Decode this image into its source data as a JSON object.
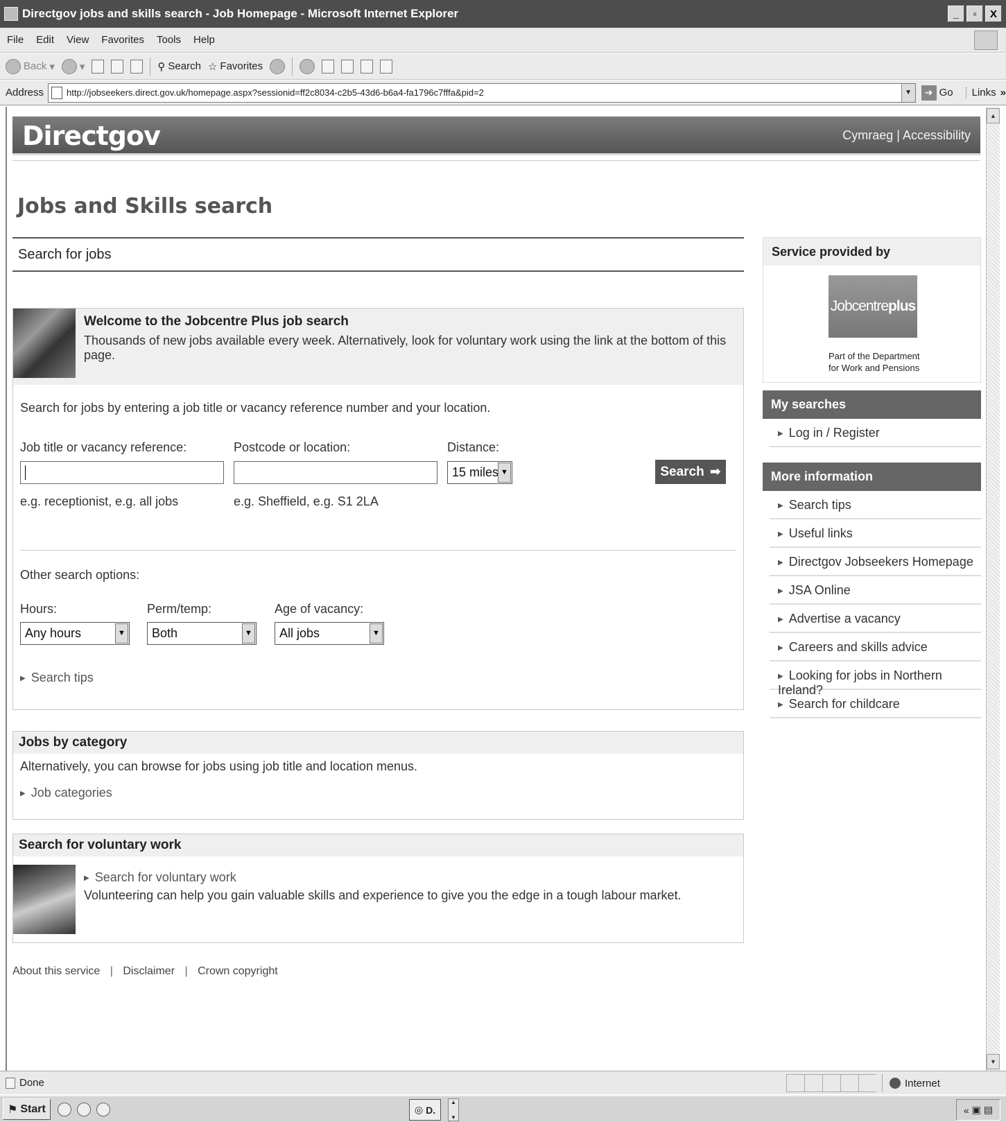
{
  "window": {
    "title": "Directgov jobs and skills search - Job Homepage - Microsoft Internet Explorer",
    "buttons": [
      "_",
      "̱",
      "X"
    ]
  },
  "menubar": [
    "File",
    "Edit",
    "View",
    "Favorites",
    "Tools",
    "Help"
  ],
  "toolbar": {
    "back": "Back",
    "search": "Search",
    "favorites": "Favorites"
  },
  "addressbar": {
    "label": "Address",
    "url": "http://jobseekers.direct.gov.uk/homepage.aspx?sessionid=ff2c8034-c2b5-43d6-b6a4-fa1796c7fffa&pid=2",
    "go": "Go",
    "links": "Links"
  },
  "site": {
    "logo": "Directgov",
    "toplinks": [
      "Cymraeg",
      "Accessibility"
    ],
    "toplink_sep": "|",
    "page_title": "Jobs and Skills search"
  },
  "search": {
    "heading": "Search for jobs",
    "welcome_title": "Welcome to the Jobcentre Plus job search",
    "welcome_text": "Thousands of new jobs available every week. Alternatively, look for voluntary work using the link at the bottom of this page.",
    "intro": "Search for jobs by entering a job title or vacancy reference number and your location.",
    "job_label": "Job title or vacancy reference:",
    "job_value": "",
    "job_hint": "e.g. receptionist, e.g. all jobs",
    "location_label": "Postcode or location:",
    "location_value": "",
    "location_hint": "e.g. Sheffield, e.g. S1 2LA",
    "distance_label": "Distance:",
    "distance_value": "15 miles",
    "search_button": "Search",
    "other_options": "Other search options:",
    "hours_label": "Hours:",
    "hours_value": "Any hours",
    "perm_label": "Perm/temp:",
    "perm_value": "Both",
    "age_label": "Age of vacancy:",
    "age_value": "All jobs",
    "tips_link": "Search tips"
  },
  "category": {
    "heading": "Jobs by category",
    "text": "Alternatively, you can browse for jobs using job title and location menus.",
    "link": "Job categories"
  },
  "voluntary": {
    "heading": "Search for voluntary work",
    "link": "Search for voluntary work",
    "text": "Volunteering can help you gain valuable skills and experience to give you the edge in a tough labour market."
  },
  "footer": {
    "links": [
      "About this service",
      "Disclaimer",
      "Crown copyright"
    ],
    "sep": "|"
  },
  "sidebar": {
    "provided_heading": "Service provided by",
    "logo_text_a": "Jobcentre",
    "logo_text_b": "plus",
    "logo_sub_1": "Part of the Department",
    "logo_sub_2": "for Work and Pensions",
    "my_searches_heading": "My searches",
    "my_searches": [
      "Log in / Register"
    ],
    "more_info_heading": "More information",
    "more_info": [
      "Search tips",
      "Useful links",
      "Directgov Jobseekers Homepage",
      "JSA Online",
      "Advertise a vacancy",
      "Careers and skills advice",
      "Looking for jobs in Northern Ireland?",
      "Search for childcare"
    ]
  },
  "statusbar": {
    "status": "Done",
    "zone": "Internet"
  },
  "taskbar": {
    "start": "Start",
    "task": "D.",
    "tray": "«"
  }
}
